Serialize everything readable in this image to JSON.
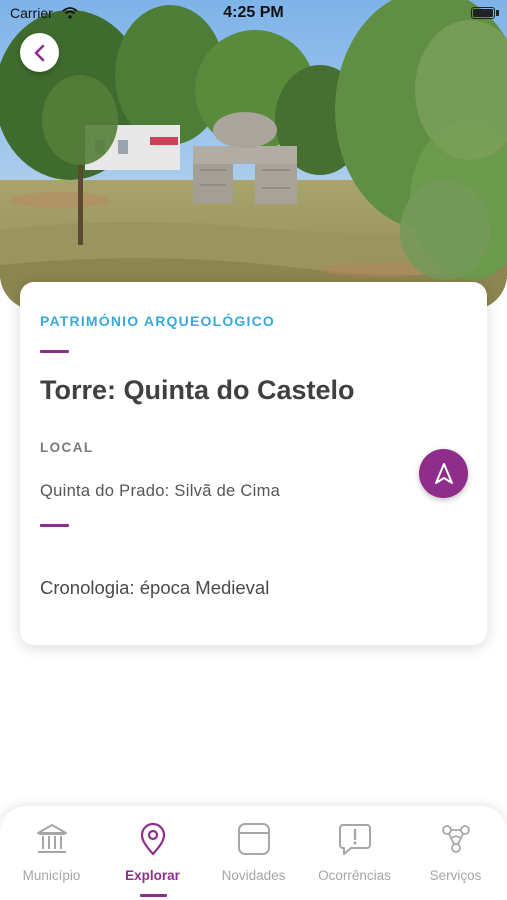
{
  "status_bar": {
    "carrier": "Carrier",
    "time": "4:25 PM"
  },
  "header": {
    "back_icon": "chevron-left-icon"
  },
  "detail": {
    "category": "PATRIMÓNIO ARQUEOLÓGICO",
    "title": "Torre: Quinta do Castelo",
    "local_label": "LOCAL",
    "local_value": "Quinta do Prado: Silvã de Cima",
    "chronology": "Cronologia: época Medieval",
    "navigate_icon": "navigation-arrow-icon"
  },
  "tabs": [
    {
      "label": "Município",
      "icon": "municipality-building-icon",
      "active": false
    },
    {
      "label": "Explorar",
      "icon": "map-pin-icon",
      "active": true
    },
    {
      "label": "Novidades",
      "icon": "news-card-icon",
      "active": false
    },
    {
      "label": "Ocorrências",
      "icon": "alert-message-icon",
      "active": false
    },
    {
      "label": "Serviços",
      "icon": "services-network-icon",
      "active": false
    }
  ],
  "colors": {
    "accent": "#8e2e8a",
    "category": "#37aadc",
    "inactive": "#a6a6a6"
  }
}
